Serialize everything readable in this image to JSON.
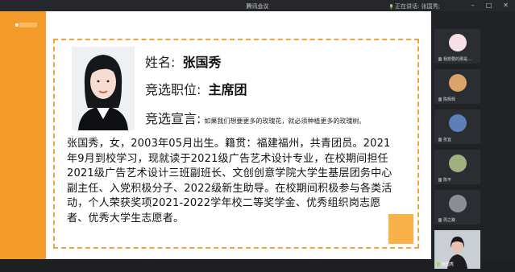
{
  "window": {
    "title": "腾讯会议",
    "speaking_text": "正在讲话: 张国秀;"
  },
  "left_strip": {
    "label": ""
  },
  "slide": {
    "name_label": "姓名:",
    "name_value": "张国秀",
    "position_label": "竞选职位:",
    "position_value": "主席团",
    "declaration_label": "竞选宣言:",
    "declaration_value": "如果我们想要更多的玫瑰花，就必须种植更多的玫瑰树。",
    "bio": "张国秀，女，2003年05月出生。籍贯：福建福州，共青团员。2021年9月到校学习，现就读于2021级广告艺术设计专业，在校期间担任2021级广告艺术设计三班副班长、文创创意学院大学生基层团务中心副主任、入党积极分子、2022级新生助导。在校期间积极参与各类活动，个人荣获奖项2021-2022学年校二等奖学金、优秀组织岗志愿者、优秀大学生志愿者。"
  },
  "participants": [
    {
      "name": "我想要的那是…",
      "avatar": "pink"
    },
    {
      "name": "陈辉辉",
      "avatar": "dog"
    },
    {
      "name": "张宜",
      "avatar": "blue"
    },
    {
      "name": "陈平",
      "avatar": "green"
    },
    {
      "name": "周之路",
      "avatar": "grey"
    }
  ],
  "self_view": {
    "name": "张国秀"
  },
  "colors": {
    "accent_orange": "#f39c2b",
    "frame_dashed": "#f0a33c",
    "background_dark": "#1d1f23"
  }
}
